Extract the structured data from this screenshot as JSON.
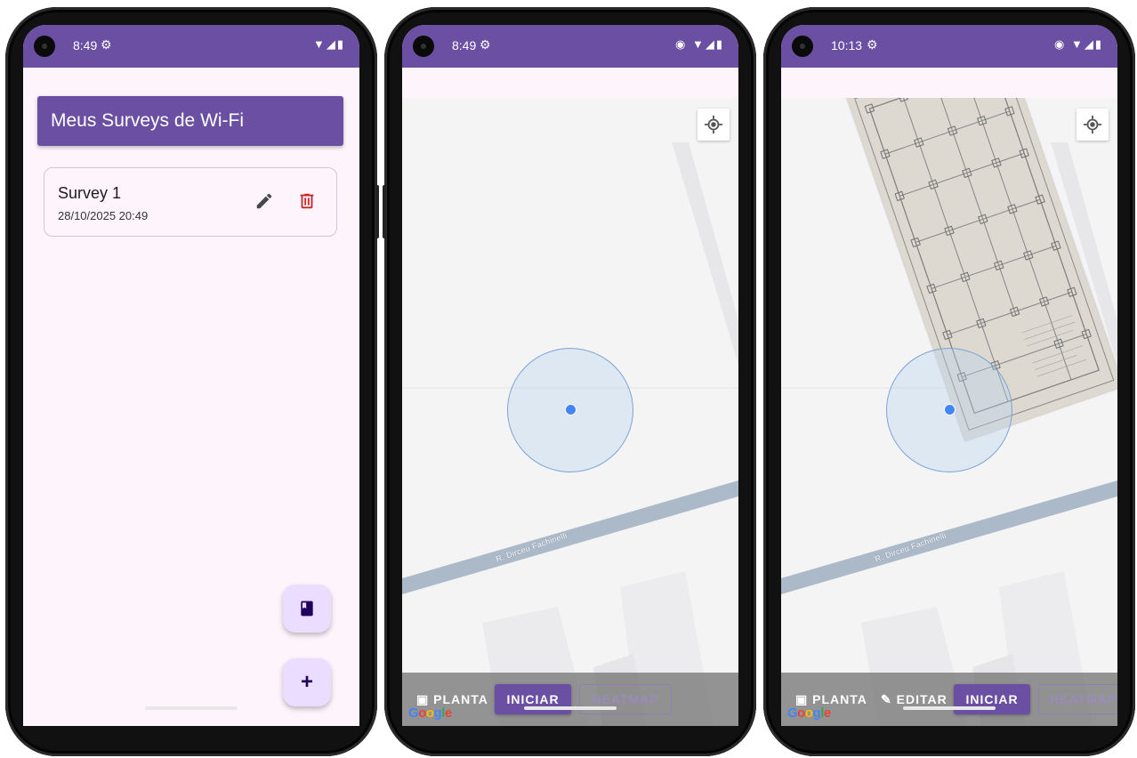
{
  "colors": {
    "primary": "#6a4fa3",
    "fab_bg": "#eaddff",
    "delete": "#c62828",
    "location_dot": "#4285f4"
  },
  "phones": [
    {
      "status": {
        "time": "8:49",
        "icons": [
          "settings-cog-icon",
          "wifi-icon",
          "signal-icon",
          "battery-icon"
        ]
      },
      "app_bar": {
        "title": "Meus Surveys de Wi-Fi"
      },
      "surveys": [
        {
          "name": "Survey 1",
          "date": "28/10/2025 20:49"
        }
      ],
      "fabs": [
        "book-icon",
        "+"
      ]
    },
    {
      "status": {
        "time": "8:49",
        "icons": [
          "settings-cog-icon",
          "location-pin-icon",
          "wifi-icon",
          "signal-icon",
          "battery-icon"
        ]
      },
      "map": {
        "street": "R. Dirceu Fachinelli",
        "attribution": "Google"
      },
      "toolbar": {
        "planta": "PLANTA",
        "iniciar": "INICIAR",
        "heatmap": "HEATMAP"
      }
    },
    {
      "status": {
        "time": "10:13",
        "icons": [
          "settings-cog-icon",
          "location-pin-icon",
          "wifi-icon",
          "signal-icon",
          "battery-icon"
        ]
      },
      "map": {
        "street": "R. Dirceu Fachinelli",
        "attribution": "Google",
        "overlay": "floor-plan-image"
      },
      "toolbar": {
        "planta": "PLANTA",
        "editar": "EDITAR",
        "iniciar": "INICIAR",
        "heatmap": "HEATMAP"
      }
    }
  ]
}
